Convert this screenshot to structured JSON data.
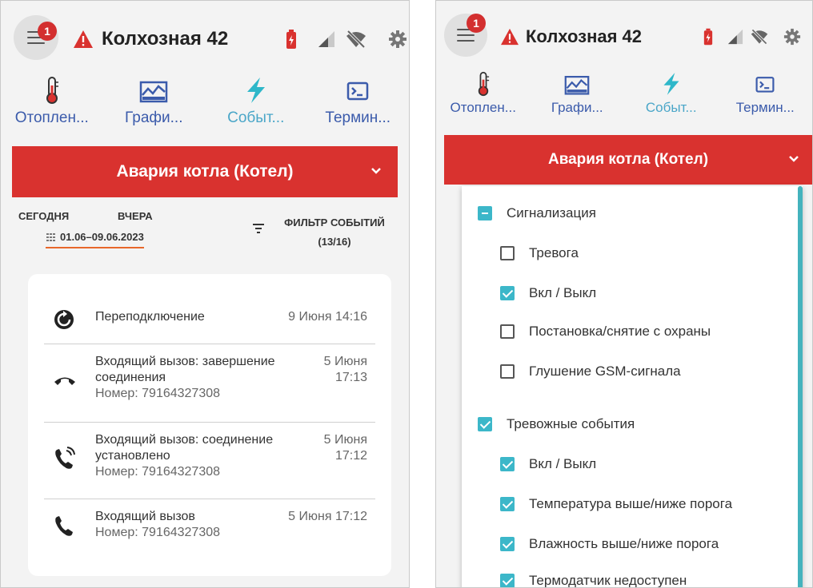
{
  "left": {
    "header": {
      "notification_count": "1",
      "title": "Колхозная 42"
    },
    "tabs": [
      {
        "label": "Отоплен...",
        "icon": "thermometer-icon"
      },
      {
        "label": "Графи...",
        "icon": "chart-icon"
      },
      {
        "label": "Событ...",
        "icon": "lightning-icon"
      },
      {
        "label": "Термин...",
        "icon": "terminal-icon"
      }
    ],
    "alarm": {
      "label": "Авария котла (Котел)"
    },
    "filters": {
      "today": "СЕГОДНЯ",
      "yesterday": "ВЧЕРА",
      "date_range": "01.06–09.06.2023",
      "event_filter": "ФИЛЬТР СОБЫТИЙ",
      "event_filter_count": "(13/16)"
    },
    "events": [
      {
        "icon": "reconnect-icon",
        "text": "Переподключение",
        "sub": "",
        "time": "9 Июня 14:16"
      },
      {
        "icon": "hangup-icon",
        "text": "Входящий вызов: завершение соединения",
        "sub": "Номер: 79164327308",
        "time": "5 Июня 17:13"
      },
      {
        "icon": "phone-ringing-icon",
        "text": "Входящий вызов: соединение установлено",
        "sub": "Номер: 79164327308",
        "time": "5 Июня 17:12"
      },
      {
        "icon": "phone-icon",
        "text": "Входящий вызов",
        "sub": "Номер: 79164327308",
        "time": "5 Июня 17:12"
      }
    ]
  },
  "right": {
    "header": {
      "notification_count": "1",
      "title": "Колхозная 42"
    },
    "tabs": [
      {
        "label": "Отоплен...",
        "icon": "thermometer-icon"
      },
      {
        "label": "Графи...",
        "icon": "chart-icon"
      },
      {
        "label": "Событ...",
        "icon": "lightning-icon"
      },
      {
        "label": "Термин...",
        "icon": "terminal-icon"
      }
    ],
    "alarm": {
      "label": "Авария котла (Котел)"
    },
    "filter_options": [
      {
        "label": "Сигнализация",
        "state": "indeterminate",
        "level": 0
      },
      {
        "label": "Тревога",
        "state": "unchecked",
        "level": 1
      },
      {
        "label": "Вкл / Выкл",
        "state": "checked",
        "level": 1
      },
      {
        "label": "Постановка/снятие с охраны",
        "state": "unchecked",
        "level": 1
      },
      {
        "label": "Глушение GSM-сигнала",
        "state": "unchecked",
        "level": 1
      },
      {
        "label": "Тревожные события",
        "state": "checked",
        "level": 0
      },
      {
        "label": "Вкл / Выкл",
        "state": "checked",
        "level": 1
      },
      {
        "label": "Температура выше/ниже порога",
        "state": "checked",
        "level": 1
      },
      {
        "label": "Влажность выше/ниже порога",
        "state": "checked",
        "level": 1
      },
      {
        "label": "Термодатчик недоступен",
        "state": "checked",
        "level": 1
      }
    ]
  },
  "colors": {
    "alarm_red": "#d9322f",
    "badge_red": "#d32f2f",
    "tab_blue": "#3b5bab",
    "active_tab": "#4aa6c8",
    "checkbox_teal": "#3cb7c9",
    "date_underline": "#e8672a"
  }
}
